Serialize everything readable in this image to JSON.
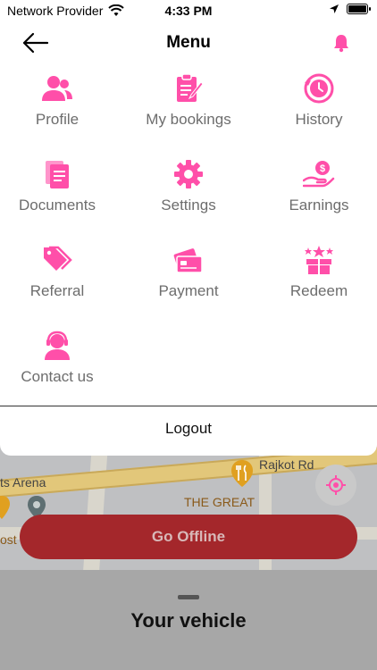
{
  "status_bar": {
    "carrier": "Network Provider",
    "time": "4:33 PM"
  },
  "header": {
    "title": "Menu"
  },
  "colors": {
    "accent": "#ff4fa9",
    "label": "#6d6d6d",
    "offline_button": "#a4272b"
  },
  "menu_items": [
    {
      "label": "Profile",
      "icon": "profile-icon"
    },
    {
      "label": "My bookings",
      "icon": "bookings-icon"
    },
    {
      "label": "History",
      "icon": "history-icon"
    },
    {
      "label": "Documents",
      "icon": "documents-icon"
    },
    {
      "label": "Settings",
      "icon": "settings-icon"
    },
    {
      "label": "Earnings",
      "icon": "earnings-icon"
    },
    {
      "label": "Referral",
      "icon": "referral-icon"
    },
    {
      "label": "Payment",
      "icon": "payment-icon"
    },
    {
      "label": "Redeem",
      "icon": "redeem-icon"
    },
    {
      "label": "Contact us",
      "icon": "contact-icon"
    }
  ],
  "logout_label": "Logout",
  "map": {
    "road_label": "Rajkot Rd",
    "place_label_1": "ts Arena",
    "place_label_2": "THE GREAT",
    "place_label_3": "ost"
  },
  "go_offline_label": "Go Offline",
  "sheet_title": "Your vehicle"
}
